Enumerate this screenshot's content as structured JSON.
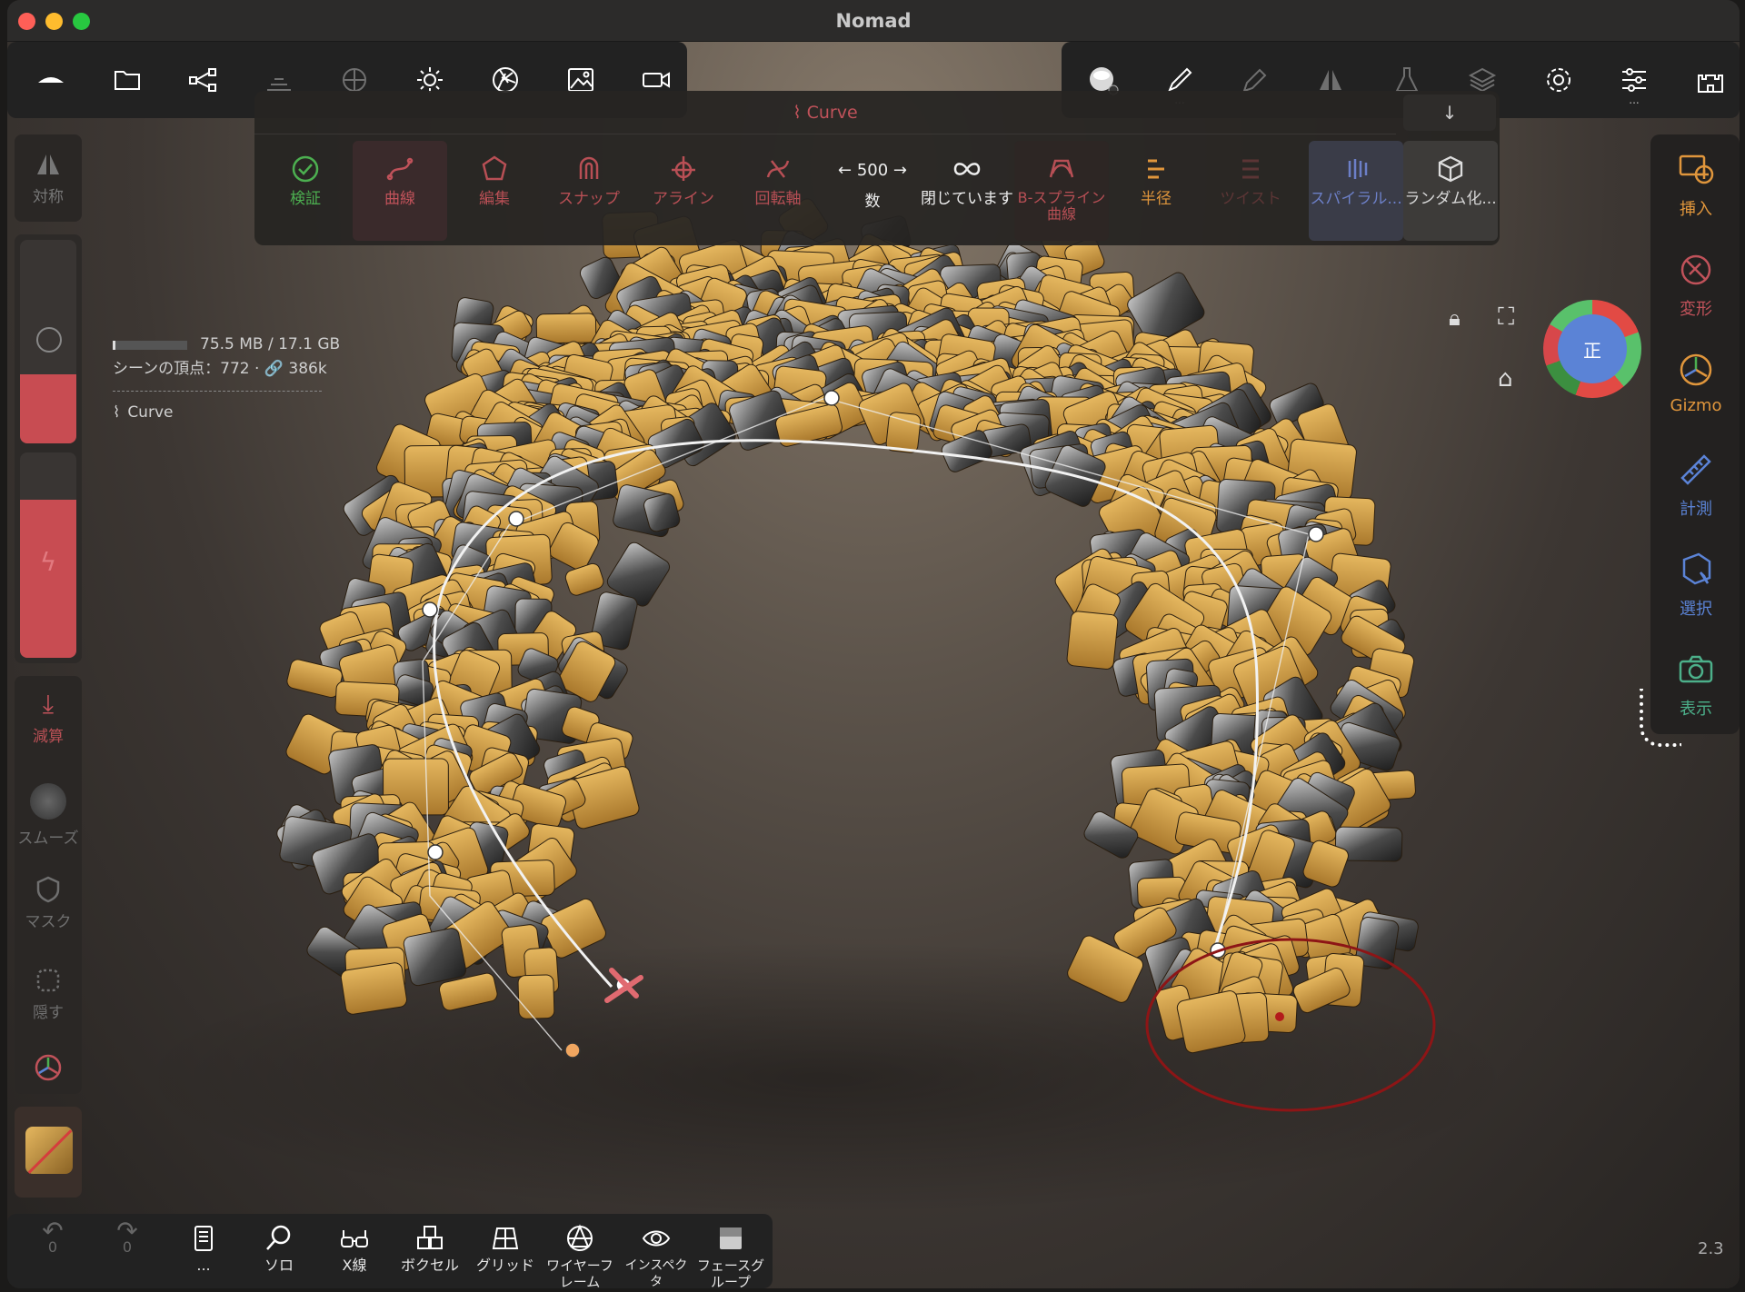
{
  "window": {
    "title": "Nomad"
  },
  "top_toolbar": {
    "left": [
      {
        "icon": "scene-icon"
      },
      {
        "icon": "folder-icon"
      },
      {
        "icon": "share-nodes-icon"
      },
      {
        "icon": "bricks-icon"
      },
      {
        "icon": "sphere-grid-icon"
      },
      {
        "icon": "sun-icon"
      },
      {
        "icon": "aperture-icon"
      },
      {
        "icon": "image-icon"
      },
      {
        "icon": "video-icon"
      }
    ],
    "right": [
      {
        "icon": "material-ball-icon"
      },
      {
        "icon": "brush-icon"
      },
      {
        "icon": "pencil-icon"
      },
      {
        "icon": "mirror-icon"
      },
      {
        "icon": "flask-icon"
      },
      {
        "icon": "layers-icon"
      },
      {
        "icon": "gear-icon"
      },
      {
        "icon": "sliders-icon"
      },
      {
        "icon": "castle-icon"
      }
    ]
  },
  "curve_panel": {
    "title": "Curve",
    "tools": [
      {
        "label": "検証",
        "icon": "check-circle-icon"
      },
      {
        "label": "曲線",
        "icon": "curve-icon"
      },
      {
        "label": "編集",
        "icon": "edit-shape-icon"
      },
      {
        "label": "スナップ",
        "icon": "magnet-icon"
      },
      {
        "label": "アライン",
        "icon": "align-icon"
      },
      {
        "label": "回転軸",
        "icon": "rotate-axis-icon"
      },
      {
        "label": "数",
        "value": "500"
      },
      {
        "label": "閉じています",
        "icon": "infinity-icon"
      },
      {
        "label": "B-スプライン曲線",
        "icon": "bspline-icon"
      },
      {
        "label": "半径",
        "icon": "radius-icon"
      },
      {
        "label": "ツイスト",
        "icon": "twist-icon"
      },
      {
        "label": "スパイラル...",
        "icon": "spiral-icon"
      },
      {
        "label": "ランダム化...",
        "icon": "random-cube-icon"
      }
    ]
  },
  "info": {
    "memory": "75.5 MB / 17.1 GB",
    "vertices": "シーンの頂点：772 · 🔗 386k",
    "object": "Curve"
  },
  "left_panel": {
    "symmetry": "対称",
    "subtract": "減算",
    "smooth": "スムーズ",
    "mask": "マスク",
    "hide": "隠す"
  },
  "right_panel": [
    {
      "label": "挿入",
      "icon": "insert-icon"
    },
    {
      "label": "変形",
      "icon": "transform-icon"
    },
    {
      "label": "Gizmo",
      "icon": "gizmo-icon"
    },
    {
      "label": "計測",
      "icon": "ruler-icon"
    },
    {
      "label": "選択",
      "icon": "select-icon"
    },
    {
      "label": "表示",
      "icon": "camera-icon"
    }
  ],
  "gizmo": {
    "face_label": "正"
  },
  "bottom_bar": {
    "undo_count": "0",
    "redo_count": "0",
    "items": [
      {
        "label": "...",
        "icon": "book-icon"
      },
      {
        "label": "ソロ",
        "icon": "search-icon"
      },
      {
        "label": "X線",
        "icon": "glasses-icon"
      },
      {
        "label": "ボクセル",
        "icon": "voxel-icon"
      },
      {
        "label": "グリッド",
        "icon": "grid-icon"
      },
      {
        "label": "ワイヤーフレーム",
        "icon": "wireframe-icon"
      },
      {
        "label": "インスペクタ",
        "icon": "eye-icon"
      },
      {
        "label": "フェースグループ",
        "icon": "facegroup-icon"
      }
    ]
  },
  "version": "2.3",
  "colors": {
    "accent": "#e0963c",
    "curve_red": "#c0525a",
    "green": "#4caf50",
    "panel": "#222222"
  }
}
